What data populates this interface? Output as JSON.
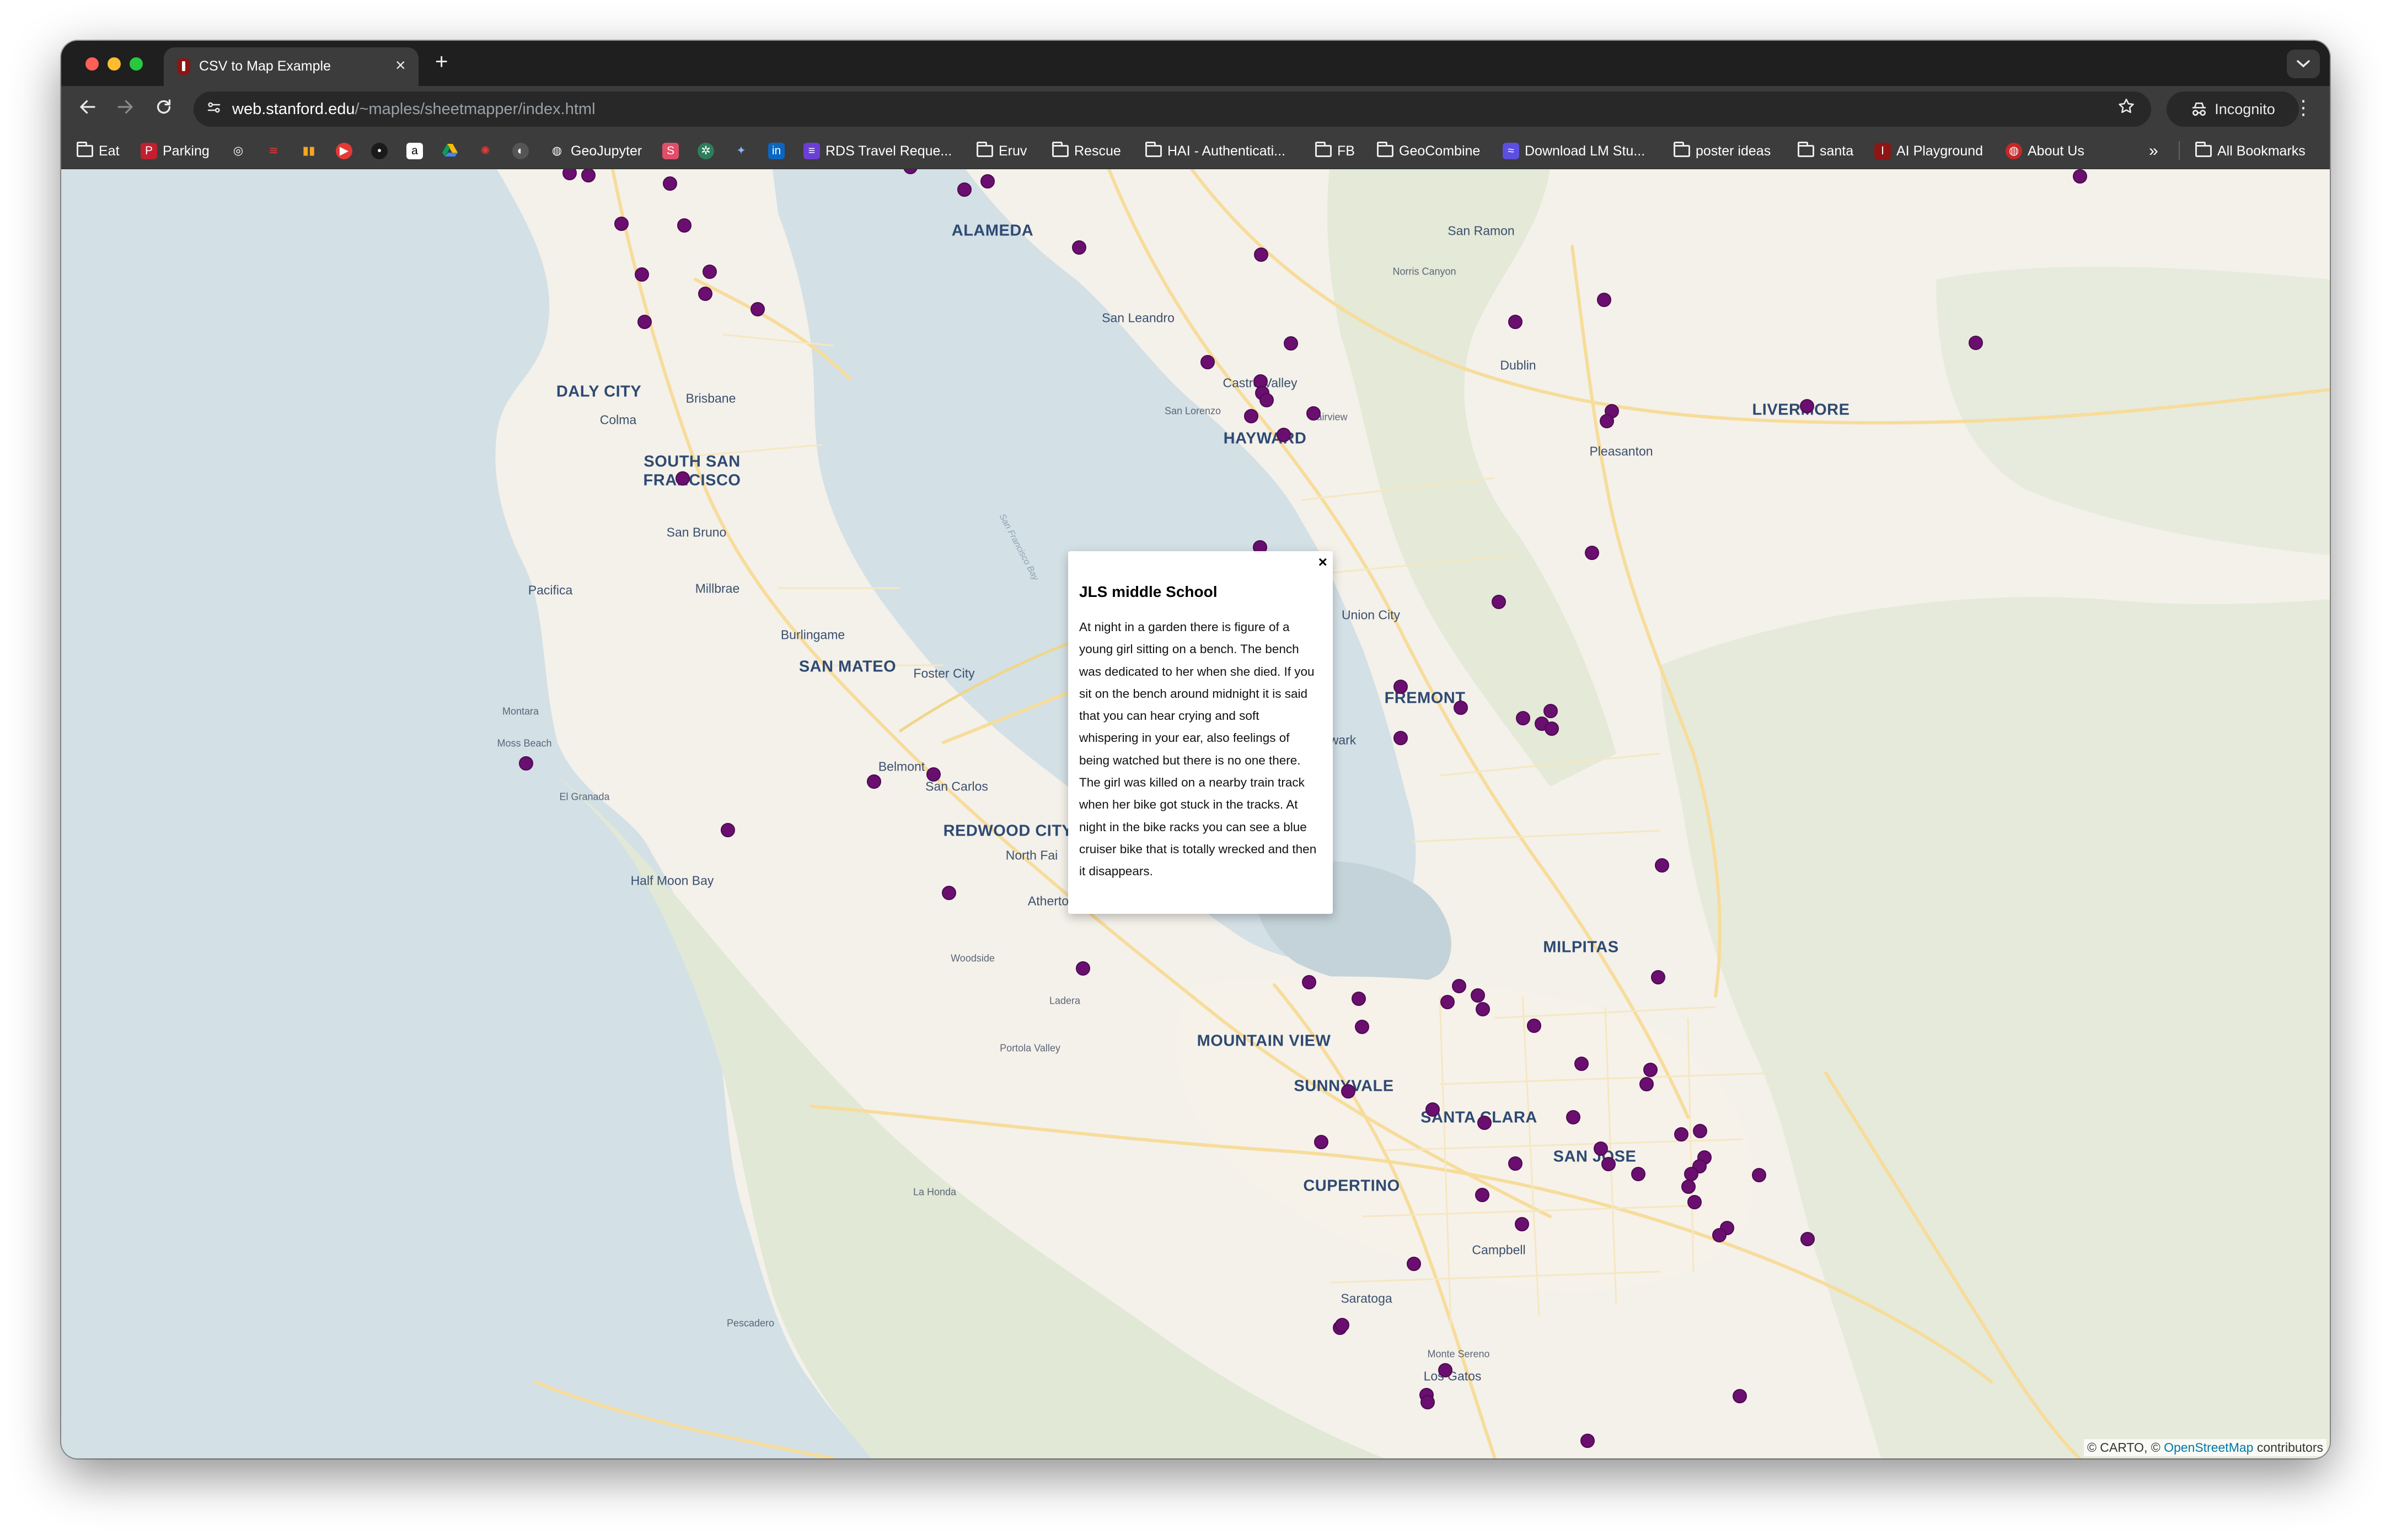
{
  "browser": {
    "tab_title": "CSV to Map Example",
    "tab_close": "×",
    "new_tab": "+",
    "url_host": "web.stanford.edu",
    "url_path": "/~maples/sheetmapper/index.html",
    "incognito_label": "Incognito"
  },
  "bookmarks": [
    {
      "label": "Eat",
      "icon": "folder-icon"
    },
    {
      "label": "Parking",
      "icon": "parking-icon"
    },
    {
      "label": "",
      "icon": "target-icon"
    },
    {
      "label": "",
      "icon": "lines-icon"
    },
    {
      "label": "",
      "icon": "bars-icon"
    },
    {
      "label": "",
      "icon": "youtube-icon"
    },
    {
      "label": "",
      "icon": "dark-circle-icon"
    },
    {
      "label": "",
      "icon": "amazon-icon"
    },
    {
      "label": "",
      "icon": "drive-icon"
    },
    {
      "label": "",
      "icon": "burst-icon"
    },
    {
      "label": "",
      "icon": "github-icon"
    },
    {
      "label": "GeoJupyter",
      "icon": "globe-icon"
    },
    {
      "label": "",
      "icon": "s-icon"
    },
    {
      "label": "",
      "icon": "openai-icon"
    },
    {
      "label": "",
      "icon": "puzzle-icon"
    },
    {
      "label": "",
      "icon": "linkedin-icon"
    },
    {
      "label": "RDS Travel Reque...",
      "icon": "form-icon"
    },
    {
      "label": "Eruv",
      "icon": "folder-icon"
    },
    {
      "label": "Rescue",
      "icon": "folder-icon"
    },
    {
      "label": "HAI - Authenticati...",
      "icon": "folder-icon"
    },
    {
      "label": "FB",
      "icon": "folder-icon"
    },
    {
      "label": "GeoCombine",
      "icon": "folder-icon"
    },
    {
      "label": "Download LM Stu...",
      "icon": "lmstudio-icon"
    },
    {
      "label": "poster ideas",
      "icon": "folder-icon"
    },
    {
      "label": "santa",
      "icon": "folder-icon"
    },
    {
      "label": "AI Playground",
      "icon": "stanford-icon"
    },
    {
      "label": "About Us",
      "icon": "globe-icon"
    }
  ],
  "bookmarks_overflow": "»",
  "all_bookmarks": "All Bookmarks",
  "map": {
    "places": [
      {
        "name": "ALAMEDA",
        "cls": "city"
      },
      {
        "name": "San Ramon",
        "cls": "town"
      },
      {
        "name": "Norris Canyon",
        "cls": "small"
      },
      {
        "name": "San Leandro",
        "cls": "town"
      },
      {
        "name": "Castro Valley",
        "cls": "town"
      },
      {
        "name": "Dublin",
        "cls": "town"
      },
      {
        "name": "DALY CITY",
        "cls": "city"
      },
      {
        "name": "Brisbane",
        "cls": "town"
      },
      {
        "name": "Colma",
        "cls": "town"
      },
      {
        "name": "San Lorenzo",
        "cls": "small"
      },
      {
        "name": "Fairview",
        "cls": "small"
      },
      {
        "name": "HAYWARD",
        "cls": "city"
      },
      {
        "name": "LIVERMORE",
        "cls": "city"
      },
      {
        "name": "Pleasanton",
        "cls": "town"
      },
      {
        "name": "SOUTH SAN",
        "cls": "city"
      },
      {
        "name": "FRANCISCO",
        "cls": "city"
      },
      {
        "name": "San Bruno",
        "cls": "town"
      },
      {
        "name": "San Francisco Bay",
        "cls": "water"
      },
      {
        "name": "Pacifica",
        "cls": "town"
      },
      {
        "name": "Millbrae",
        "cls": "town"
      },
      {
        "name": "Union City",
        "cls": "town"
      },
      {
        "name": "Burlingame",
        "cls": "town"
      },
      {
        "name": "SAN MATEO",
        "cls": "city"
      },
      {
        "name": "Foster City",
        "cls": "town"
      },
      {
        "name": "FREMONT",
        "cls": "city"
      },
      {
        "name": "Montara",
        "cls": "small"
      },
      {
        "name": "Moss Beach",
        "cls": "small"
      },
      {
        "name": "wark",
        "cls": "town"
      },
      {
        "name": "Belmont",
        "cls": "town"
      },
      {
        "name": "San Carlos",
        "cls": "town"
      },
      {
        "name": "El Granada",
        "cls": "small"
      },
      {
        "name": "REDWOOD CITY",
        "cls": "city"
      },
      {
        "name": "North Fai",
        "cls": "town"
      },
      {
        "name": "Half Moon Bay",
        "cls": "town"
      },
      {
        "name": "Atherto",
        "cls": "town"
      },
      {
        "name": "MILPITAS",
        "cls": "city"
      },
      {
        "name": "Woodside",
        "cls": "small"
      },
      {
        "name": "Ladera",
        "cls": "small"
      },
      {
        "name": "MOUNTAIN VIEW",
        "cls": "city"
      },
      {
        "name": "Portola Valley",
        "cls": "small"
      },
      {
        "name": "SUNNYVALE",
        "cls": "city"
      },
      {
        "name": "SANTA CLARA",
        "cls": "city"
      },
      {
        "name": "SAN JOSE",
        "cls": "city"
      },
      {
        "name": "CUPERTINO",
        "cls": "city"
      },
      {
        "name": "La Honda",
        "cls": "small"
      },
      {
        "name": "Campbell",
        "cls": "town"
      },
      {
        "name": "Saratoga",
        "cls": "town"
      },
      {
        "name": "Pescadero",
        "cls": "small"
      },
      {
        "name": "Monte Sereno",
        "cls": "small"
      },
      {
        "name": "Los Gatos",
        "cls": "town"
      }
    ],
    "marker_count_note": ""
  },
  "popup": {
    "close": "×",
    "title": "JLS middle School",
    "body": "At night in a garden there is figure of a young girl sitting on a bench. The bench was dedicated to her when she died. If you sit on the bench around midnight it is said that you can hear crying and soft whispering in your ear, also feelings of being watched but there is no one there. The girl was killed on a nearby train track when her bike got stuck in the tracks. At night in the bike racks you can see a blue cruiser bike that is totally wrecked and then it disappears."
  },
  "attribution": {
    "carto": "© CARTO, © ",
    "osm": "OpenStreetMap",
    "contributors": " contributors"
  },
  "colors": {
    "marker": "#6a0f70",
    "water": "#d3e0e6",
    "land": "#f4f1ea",
    "park": "#e4e9d8",
    "road": "#f7dc9b"
  }
}
